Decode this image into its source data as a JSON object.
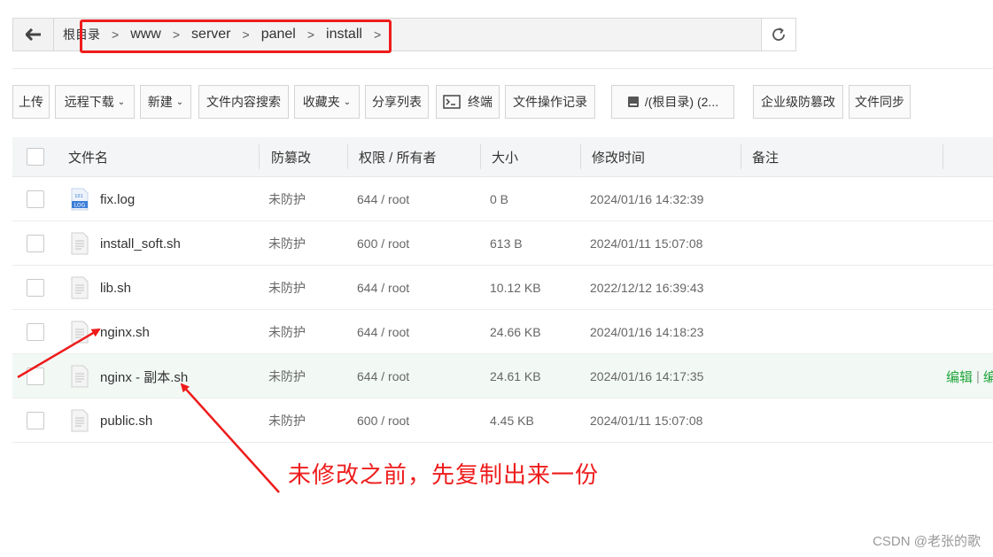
{
  "path": {
    "crumbs": [
      "根目录",
      "www",
      "server",
      "panel",
      "install"
    ],
    "separator": ">"
  },
  "toolbar": {
    "upload": "上传",
    "remote_download": "远程下载",
    "new": "新建",
    "content_search": "文件内容搜索",
    "favorites": "收藏夹",
    "share_list": "分享列表",
    "terminal": "终端",
    "operation_log": "文件操作记录",
    "disk": "/(根目录) (2...",
    "tamper_proof": "企业级防篡改",
    "file_sync": "文件同步"
  },
  "table": {
    "headers": {
      "name": "文件名",
      "tamper": "防篡改",
      "perm": "权限 / 所有者",
      "size": "大小",
      "mtime": "修改时间",
      "note": "备注"
    },
    "rows": [
      {
        "name": "fix.log",
        "tamper": "未防护",
        "perm": "644 / root",
        "size": "0 B",
        "mtime": "2024/01/16 14:32:39",
        "icon": "log-file-icon"
      },
      {
        "name": "install_soft.sh",
        "tamper": "未防护",
        "perm": "600 / root",
        "size": "613 B",
        "mtime": "2024/01/11 15:07:08",
        "icon": "file-icon"
      },
      {
        "name": "lib.sh",
        "tamper": "未防护",
        "perm": "644 / root",
        "size": "10.12 KB",
        "mtime": "2022/12/12 16:39:43",
        "icon": "file-icon"
      },
      {
        "name": "nginx.sh",
        "tamper": "未防护",
        "perm": "644 / root",
        "size": "24.66 KB",
        "mtime": "2024/01/16 14:18:23",
        "icon": "file-icon"
      },
      {
        "name": "nginx - 副本.sh",
        "tamper": "未防护",
        "perm": "644 / root",
        "size": "24.61 KB",
        "mtime": "2024/01/16 14:17:35",
        "icon": "file-icon"
      },
      {
        "name": "public.sh",
        "tamper": "未防护",
        "perm": "600 / root",
        "size": "4.45 KB",
        "mtime": "2024/01/11 15:07:08",
        "icon": "file-icon"
      }
    ],
    "row_ops": {
      "edit": "编辑",
      "sep": "|",
      "edit2": "编"
    }
  },
  "annotation": {
    "text": "未修改之前，先复制出来一份",
    "color": "#ee1c1c"
  },
  "watermark": "CSDN @老张的歌",
  "colors": {
    "accent_green": "#20a53a",
    "annotation_red": "#ee1c1c"
  }
}
